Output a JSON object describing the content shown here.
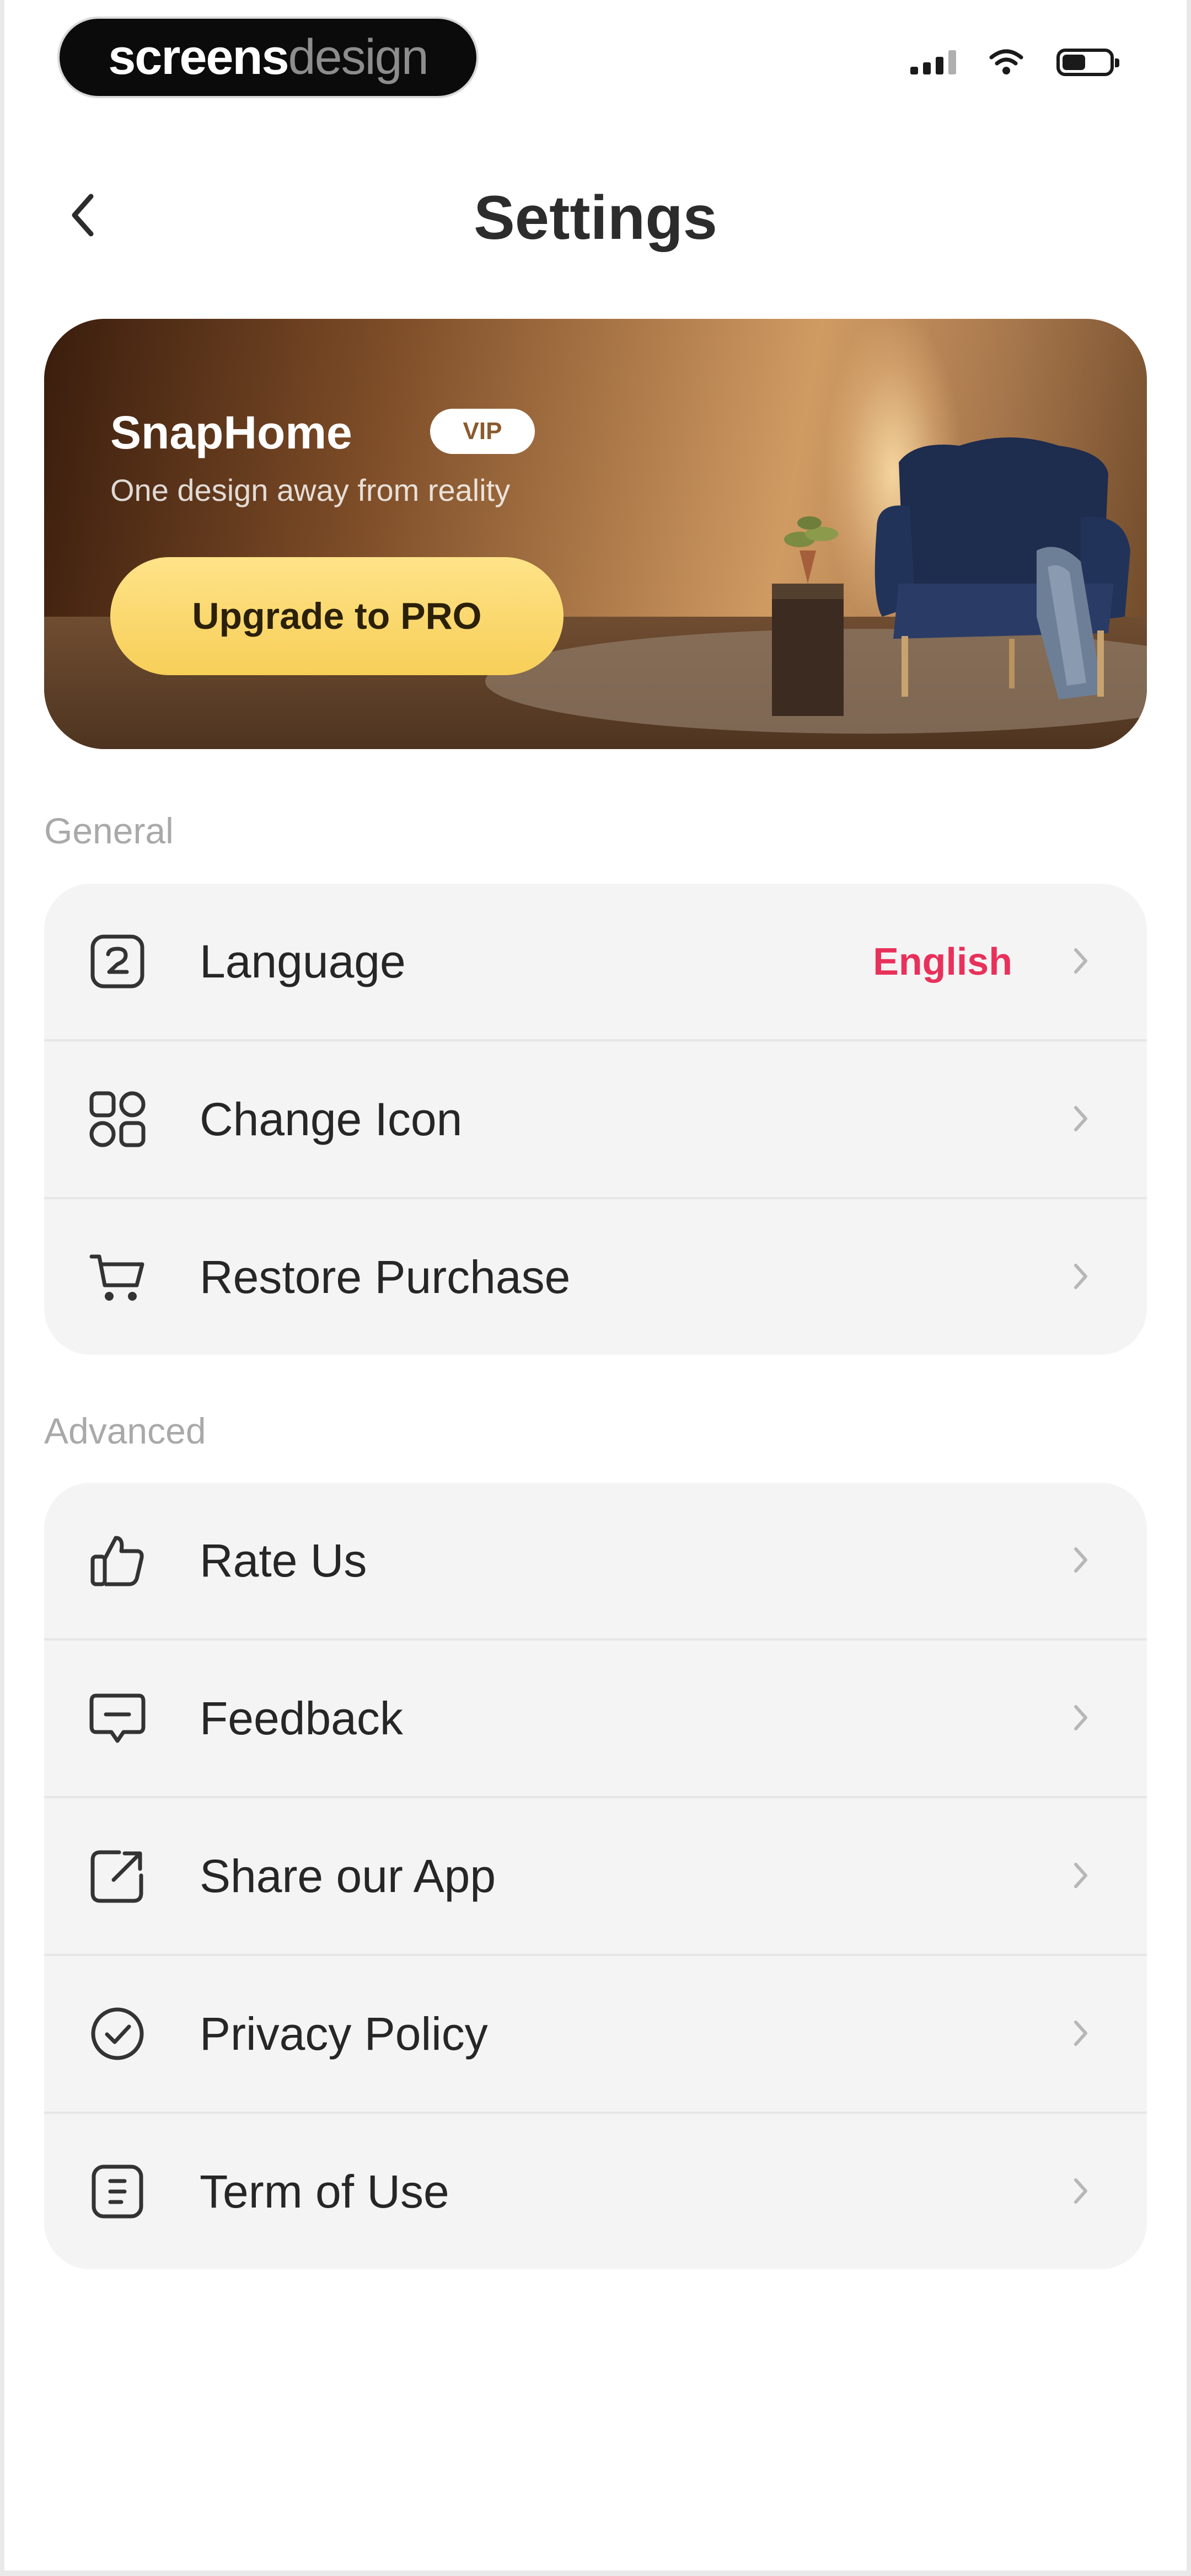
{
  "status_bar": {
    "watermark": {
      "part1": "screens",
      "part2": "design"
    },
    "icons": [
      "signal-icon",
      "wifi-icon",
      "battery-icon"
    ],
    "battery_level": 0.5
  },
  "header": {
    "back_icon": "chevron-left-icon",
    "title": "Settings"
  },
  "banner": {
    "title": "SnapHome",
    "badge": "VIP",
    "subtitle": "One design away from reality",
    "button_label": "Upgrade to PRO",
    "button_color": "#f7cf58"
  },
  "general": {
    "label": "General",
    "items": [
      {
        "icon": "language-icon",
        "label": "Language",
        "value": "English"
      },
      {
        "icon": "grid-icon",
        "label": "Change Icon"
      },
      {
        "icon": "cart-icon",
        "label": "Restore Purchase"
      }
    ]
  },
  "advanced": {
    "label": "Advanced",
    "items": [
      {
        "icon": "thumbs-up-icon",
        "label": "Rate Us"
      },
      {
        "icon": "chat-icon",
        "label": "Feedback"
      },
      {
        "icon": "share-icon",
        "label": "Share our App"
      },
      {
        "icon": "shield-check-icon",
        "label": "Privacy Policy"
      },
      {
        "icon": "document-icon",
        "label": "Term of Use"
      }
    ]
  },
  "colors": {
    "accent_value": "#e8315a",
    "card_bg": "#f4f4f4",
    "section_label": "#a9a9a9"
  }
}
